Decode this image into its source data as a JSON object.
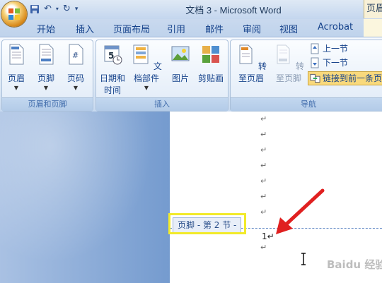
{
  "window": {
    "title": "文档 3 - Microsoft Word",
    "context_tab_title": "页眉"
  },
  "qat": {
    "save_icon": "save-icon",
    "undo_icon": "undo-icon",
    "redo_icon": "redo-icon",
    "customize": "▾"
  },
  "tabs": [
    "开始",
    "插入",
    "页面布局",
    "引用",
    "邮件",
    "审阅",
    "视图",
    "Acrobat"
  ],
  "groups": {
    "header_footer": {
      "label": "页眉和页脚",
      "buttons": [
        "页眉",
        "页脚",
        "页码"
      ]
    },
    "insert": {
      "label": "插入",
      "datetime_line1": "日期和",
      "datetime_line2": "时间",
      "quickparts": "文档部件",
      "picture": "图片",
      "clipart": "剪贴画"
    },
    "navigation": {
      "label": "导航",
      "goto_header": "转至页眉",
      "goto_footer": "转至页脚",
      "prev_section": "上一节",
      "next_section": "下一节",
      "link_previous": "链接到前一条页"
    }
  },
  "document": {
    "para_mark": "↵",
    "footer_tag": "页脚 - 第 2 节 -",
    "page_number": "1↵",
    "watermark": "经验"
  },
  "colors": {
    "highlight": "#f2ea2a",
    "arrow": "#e02020",
    "link_prev_active": "#f9d97c"
  }
}
